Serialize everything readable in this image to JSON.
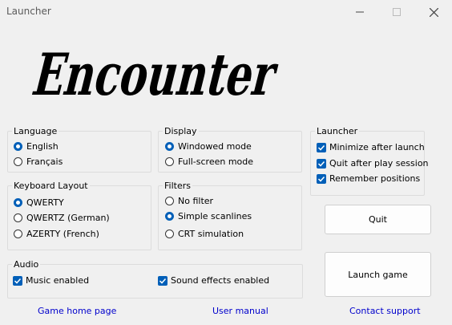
{
  "window": {
    "title": "Launcher",
    "logo_text": "Encounter",
    "controls": [
      "minimize-icon",
      "maximize-icon",
      "close-icon"
    ]
  },
  "language": {
    "legend": "Language",
    "options": [
      {
        "label": "English",
        "selected": true
      },
      {
        "label": "Français",
        "selected": false
      }
    ]
  },
  "display": {
    "legend": "Display",
    "options": [
      {
        "label": "Windowed mode",
        "selected": true
      },
      {
        "label": "Full-screen mode",
        "selected": false
      }
    ]
  },
  "keyboard": {
    "legend": "Keyboard Layout",
    "options": [
      {
        "label": "QWERTY",
        "selected": true
      },
      {
        "label": "QWERTZ (German)",
        "selected": false
      },
      {
        "label": "AZERTY (French)",
        "selected": false
      }
    ]
  },
  "filters": {
    "legend": "Filters",
    "options": [
      {
        "label": "No filter",
        "selected": false
      },
      {
        "label": "Simple scanlines",
        "selected": true
      },
      {
        "label": "CRT simulation",
        "selected": false
      }
    ]
  },
  "launcher": {
    "legend": "Launcher",
    "checks": [
      {
        "label": "Minimize after launch",
        "checked": true
      },
      {
        "label": "Quit after play session",
        "checked": true
      },
      {
        "label": "Remember positions",
        "checked": true
      }
    ]
  },
  "audio": {
    "legend": "Audio",
    "checks": [
      {
        "label": "Music enabled",
        "checked": true
      },
      {
        "label": "Sound effects enabled",
        "checked": true
      }
    ]
  },
  "buttons": {
    "quit": "Quit",
    "launch": "Launch game"
  },
  "links": {
    "home": "Game home page",
    "manual": "User manual",
    "support": "Contact support"
  },
  "colors": {
    "accent": "#005fb8",
    "link": "#0000cc",
    "background": "#f0f0f0"
  }
}
